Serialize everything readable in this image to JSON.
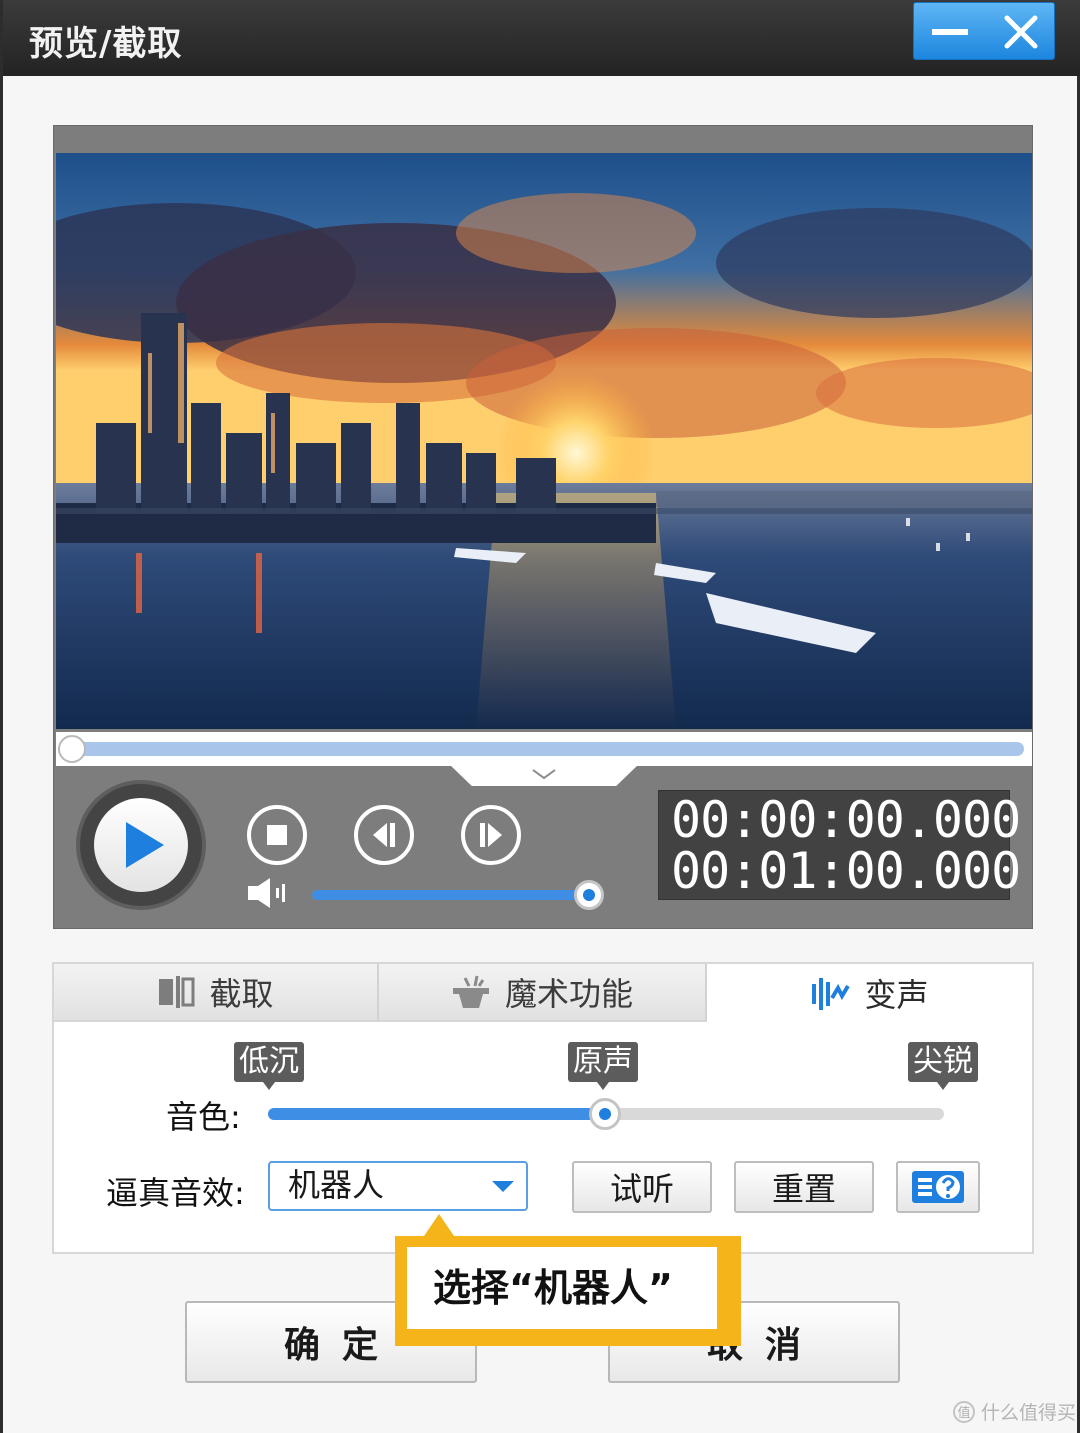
{
  "window": {
    "title": "预览/截取"
  },
  "player": {
    "current_time": "00:00:00.000",
    "total_time": "00:01:00.000",
    "progress": 0,
    "volume": 1.0
  },
  "tabs": [
    {
      "label": "截取",
      "icon": "clip-icon",
      "active": false
    },
    {
      "label": "魔术功能",
      "icon": "magic-hat-icon",
      "active": false
    },
    {
      "label": "变声",
      "icon": "soundwave-icon",
      "active": true
    }
  ],
  "voice": {
    "tone_label": "音色:",
    "tone_marks": {
      "low": "低沉",
      "original": "原声",
      "sharp": "尖锐"
    },
    "tone_value": 0.5,
    "effect_label": "逼真音效:",
    "effect_selected": "机器人",
    "listen_button": "试听",
    "reset_button": "重置"
  },
  "footer": {
    "ok_button": "确定",
    "cancel_button": "取消"
  },
  "annotation": {
    "text": "选择“机器人”"
  },
  "watermark": {
    "text": "什么值得买",
    "icon_text": "值"
  },
  "colors": {
    "accent": "#1e7fde",
    "callout": "#f4b41a",
    "titlebar": "#2d2d2d"
  }
}
